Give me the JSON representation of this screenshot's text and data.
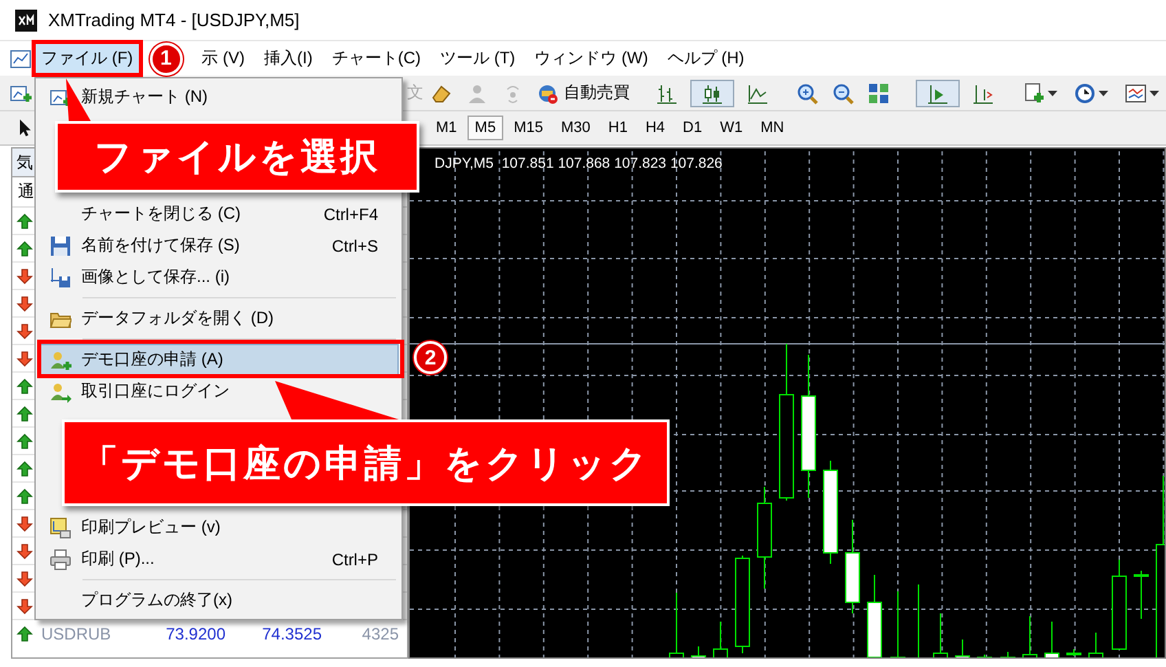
{
  "window": {
    "title": "XMTrading MT4 - [USDJPY,M5]"
  },
  "menu_bar": [
    {
      "label": "ファイル (F)",
      "selected": true
    },
    {
      "label": "示 (V)",
      "selected": false
    },
    {
      "label": "挿入(I)",
      "selected": false
    },
    {
      "label": "チャート(C)",
      "selected": false
    },
    {
      "label": "ツール (T)",
      "selected": false
    },
    {
      "label": "ウィンドウ (W)",
      "selected": false
    },
    {
      "label": "ヘルプ (H)",
      "selected": false
    }
  ],
  "toolbar": {
    "order_label": {
      "label": "文",
      "disabled": true
    },
    "autotrade_button": "自動売買"
  },
  "periods": [
    {
      "label": "M1",
      "selected": false
    },
    {
      "label": "M5",
      "selected": true
    },
    {
      "label": "M15",
      "selected": false
    },
    {
      "label": "M30",
      "selected": false
    },
    {
      "label": "H1",
      "selected": false
    },
    {
      "label": "H4",
      "selected": false
    },
    {
      "label": "D1",
      "selected": false
    },
    {
      "label": "W1",
      "selected": false
    },
    {
      "label": "MN",
      "selected": false
    }
  ],
  "market_watch": {
    "title": "気",
    "column_header": "通",
    "arrows": [
      {
        "rising": true
      },
      {
        "rising": true
      },
      {
        "rising": false
      },
      {
        "rising": false
      },
      {
        "rising": false
      },
      {
        "rising": false
      },
      {
        "rising": true
      },
      {
        "rising": true
      },
      {
        "rising": true
      },
      {
        "rising": true
      },
      {
        "rising": true
      },
      {
        "rising": false
      },
      {
        "rising": false
      },
      {
        "rising": false
      },
      {
        "rising": false
      }
    ],
    "last_row": {
      "symbol": "USDRUB",
      "bid": "73.9200",
      "ask": "74.3525",
      "spread": "4325",
      "rising": true
    }
  },
  "chart": {
    "caption": "DJPY,M5  107.851 107.868 107.823 107.826"
  },
  "file_menu": [
    {
      "kind": "item",
      "label": "新規チャート (N)",
      "selected": false
    },
    {
      "kind": "item",
      "label": "チャートを閉じる (C)",
      "shortcut": "Ctrl+F4",
      "selected": false
    },
    {
      "kind": "item",
      "label": "名前を付けて保存 (S)",
      "shortcut": "Ctrl+S",
      "selected": false
    },
    {
      "kind": "item",
      "label": "画像として保存... (i)",
      "selected": false
    },
    {
      "kind": "separator"
    },
    {
      "kind": "item",
      "label": "データフォルダを開く (D)",
      "selected": false
    },
    {
      "kind": "separator"
    },
    {
      "kind": "item",
      "label": "デモ口座の申請 (A)",
      "selected": true
    },
    {
      "kind": "item",
      "label": "取引口座にログイン",
      "selected": false
    },
    {
      "kind": "item",
      "label": "印刷プレビュー (v)",
      "selected": false
    },
    {
      "kind": "item",
      "label": "印刷 (P)...",
      "shortcut": "Ctrl+P",
      "selected": false
    },
    {
      "kind": "separator"
    },
    {
      "kind": "item",
      "label": "プログラムの終了(x)",
      "selected": false
    }
  ],
  "callouts": [
    {
      "number": "1",
      "text": "ファイルを選択"
    },
    {
      "number": "2",
      "text": "「デモ口座の申請」をクリック"
    }
  ]
}
